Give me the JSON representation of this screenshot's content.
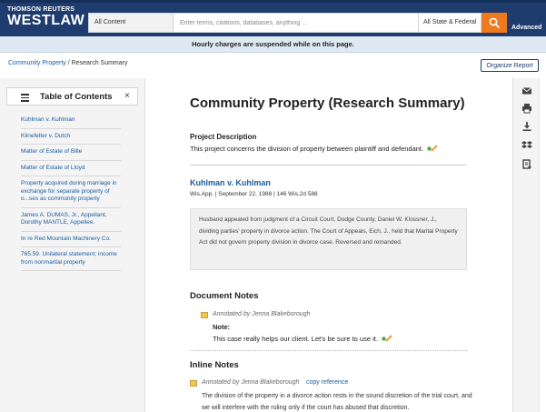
{
  "header": {
    "brand_top": "THOMSON REUTERS",
    "brand_main": "WESTLAW",
    "content_select": "All Content",
    "search_placeholder": "Enter terms, citations, databases, anything ...",
    "jurisdiction": "All State & Federal",
    "advanced": "Advanced",
    "colors": {
      "bar": "#1e3c6d",
      "search_button": "#ee7a1d"
    }
  },
  "notice": "Hourly charges are suspended while on this page.",
  "breadcrumb": {
    "link": "Community Property",
    "separator": " / ",
    "current": "Research Summary"
  },
  "organize_button": "Organize Report",
  "toc": {
    "title": "Table of Contents",
    "close": "×",
    "items": [
      "Kuhlman v. Kuhlman",
      "Klinefelter v. Dutch",
      "Matter of Estate of Bille",
      "Matter of Estate of Lloyd",
      "Property acquired during marriage in exchange for separate property of o...ses as community property",
      "James A. DUMAS, Jr., Appellant, Dorothy MANTLE, Appellee.",
      "In re Red Mountain Machinery Co.",
      "765.59. Unilateral statement; income from nonmarital property"
    ]
  },
  "main": {
    "title": "Community Property (Research Summary)",
    "project_description_label": "Project Description",
    "project_description": "This project concerns the division of property between plaintiff and defendant.",
    "case": {
      "name": "Kuhlman v. Kuhlman",
      "citation": "Wis.App. | September 22, 1988 | 146 Wis.2d 588",
      "summary": "Husband appealed from judgment of a Circuit Court, Dodge County, Daniel W. Klossner, J., dividing parties' property in divorce action.    The Court of Appeals, Eich, J., held that Marital Property Act did not govern property division in divorce case. Reversed and remanded."
    },
    "document_notes": {
      "title": "Document Notes",
      "annotation": "Annotated by Jenna Blakeborough",
      "note_label": "Note:",
      "note_text": "This case really helps our client. Let's be sure to use it."
    },
    "inline_notes": {
      "title": "Inline Notes",
      "annotation": "Annotated by Jenna Blakeborough",
      "copy_reference": "copy reference",
      "text": "The division of the property in a divorce action rests in the sound discretion of the trial court, and we will interfere with the ruling only if the court has abused that discretion."
    }
  },
  "tools": [
    "email-icon",
    "print-icon",
    "download-icon",
    "dropbox-icon",
    "kindle-icon"
  ]
}
